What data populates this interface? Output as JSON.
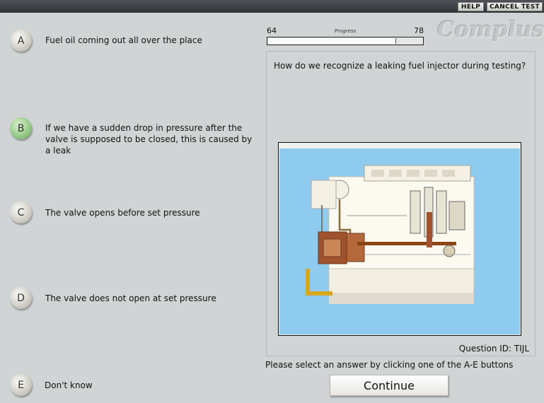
{
  "topbar": {
    "help_label": "HELP",
    "cancel_label": "CANCEL TEST"
  },
  "logo": "Complus",
  "progress": {
    "current": "64",
    "label": "Progress",
    "total": "78",
    "fraction": 0.82
  },
  "question": {
    "text": "How do we recognize a leaking fuel injector during testing?",
    "id_text": "Question ID: TIJL"
  },
  "options": [
    {
      "letter": "A",
      "text": "Fuel oil coming out all over the place"
    },
    {
      "letter": "B",
      "text": "If we have a sudden drop in pressure after the valve is supposed to be closed, this is caused by a leak"
    },
    {
      "letter": "C",
      "text": "The valve opens before set pressure"
    },
    {
      "letter": "D",
      "text": "The valve does not open at set pressure"
    },
    {
      "letter": "E",
      "text": "Don't know"
    }
  ],
  "selected_option": "B",
  "instruction": "Please select an answer by clicking one of the A-E buttons",
  "continue_label": "Continue",
  "colors": {
    "selected": "#92c784",
    "image_bg": "#8ecbef"
  }
}
